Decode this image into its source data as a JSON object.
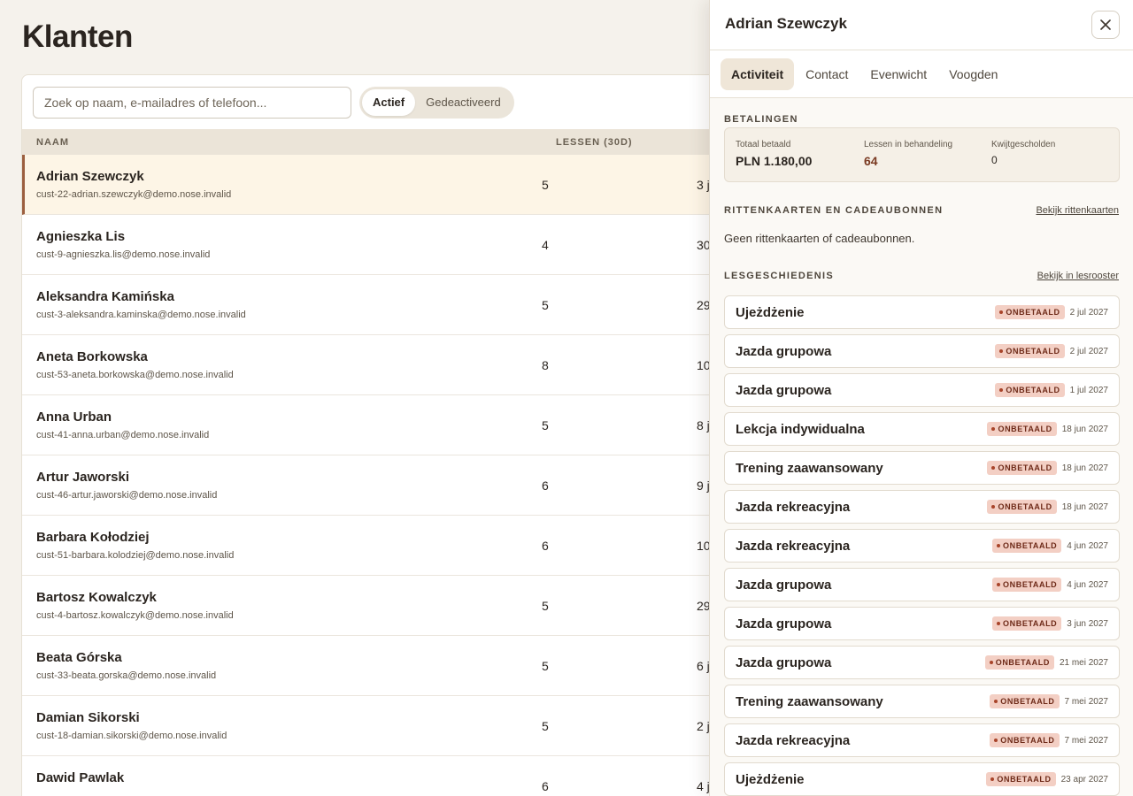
{
  "page": {
    "title": "Klanten"
  },
  "search": {
    "placeholder": "Zoek op naam, e-mailadres of telefoon..."
  },
  "filter": {
    "options": [
      "Actief",
      "Gedeactiveerd"
    ],
    "selected": "Actief"
  },
  "table": {
    "columns": {
      "name": "NAAM",
      "lessons": "LESSEN (30D)"
    },
    "rows": [
      {
        "name": "Adrian Szewczyk",
        "email": "cust-22-adrian.szewczyk@demo.nose.invalid",
        "lessons": "5",
        "last": "3 j",
        "selected": true
      },
      {
        "name": "Agnieszka Lis",
        "email": "cust-9-agnieszka.lis@demo.nose.invalid",
        "lessons": "4",
        "last": "30"
      },
      {
        "name": "Aleksandra Kamińska",
        "email": "cust-3-aleksandra.kaminska@demo.nose.invalid",
        "lessons": "5",
        "last": "29"
      },
      {
        "name": "Aneta Borkowska",
        "email": "cust-53-aneta.borkowska@demo.nose.invalid",
        "lessons": "8",
        "last": "10"
      },
      {
        "name": "Anna Urban",
        "email": "cust-41-anna.urban@demo.nose.invalid",
        "lessons": "5",
        "last": "8 j"
      },
      {
        "name": "Artur Jaworski",
        "email": "cust-46-artur.jaworski@demo.nose.invalid",
        "lessons": "6",
        "last": "9 j"
      },
      {
        "name": "Barbara Kołodziej",
        "email": "cust-51-barbara.kolodziej@demo.nose.invalid",
        "lessons": "6",
        "last": "10"
      },
      {
        "name": "Bartosz Kowalczyk",
        "email": "cust-4-bartosz.kowalczyk@demo.nose.invalid",
        "lessons": "5",
        "last": "29"
      },
      {
        "name": "Beata Górska",
        "email": "cust-33-beata.gorska@demo.nose.invalid",
        "lessons": "5",
        "last": "6 j"
      },
      {
        "name": "Damian Sikorski",
        "email": "cust-18-damian.sikorski@demo.nose.invalid",
        "lessons": "5",
        "last": "2 j"
      },
      {
        "name": "Dawid Pawlak",
        "email": "",
        "lessons": "6",
        "last": "4 j"
      }
    ]
  },
  "drawer": {
    "title": "Adrian Szewczyk",
    "close_icon": "close-icon",
    "tabs": [
      "Activiteit",
      "Contact",
      "Evenwicht",
      "Voogden"
    ],
    "active_tab": "Activiteit",
    "payments": {
      "label": "BETALINGEN",
      "total_label": "Totaal betaald",
      "total_value": "PLN 1.180,00",
      "pending_label": "Lessen in behandeling",
      "pending_value": "64",
      "waived_label": "Kwijtgescholden",
      "waived_value": "0"
    },
    "passes": {
      "label": "RITTENKAARTEN EN CADEAUBONNEN",
      "link": "Bekijk rittenkaarten",
      "empty": "Geen rittenkaarten of cadeaubonnen."
    },
    "history": {
      "label": "LESGESCHIEDENIS",
      "link": "Bekijk in lesrooster",
      "items": [
        {
          "name": "Ujeżdżenie",
          "status": "ONBETAALD",
          "date": "2 jul 2027"
        },
        {
          "name": "Jazda grupowa",
          "status": "ONBETAALD",
          "date": "2 jul 2027"
        },
        {
          "name": "Jazda grupowa",
          "status": "ONBETAALD",
          "date": "1 jul 2027"
        },
        {
          "name": "Lekcja indywidualna",
          "status": "ONBETAALD",
          "date": "18 jun 2027"
        },
        {
          "name": "Trening zaawansowany",
          "status": "ONBETAALD",
          "date": "18 jun 2027"
        },
        {
          "name": "Jazda rekreacyjna",
          "status": "ONBETAALD",
          "date": "18 jun 2027"
        },
        {
          "name": "Jazda rekreacyjna",
          "status": "ONBETAALD",
          "date": "4 jun 2027"
        },
        {
          "name": "Jazda grupowa",
          "status": "ONBETAALD",
          "date": "4 jun 2027"
        },
        {
          "name": "Jazda grupowa",
          "status": "ONBETAALD",
          "date": "3 jun 2027"
        },
        {
          "name": "Jazda grupowa",
          "status": "ONBETAALD",
          "date": "21 mei 2027"
        },
        {
          "name": "Trening zaawansowany",
          "status": "ONBETAALD",
          "date": "7 mei 2027"
        },
        {
          "name": "Jazda rekreacyjna",
          "status": "ONBETAALD",
          "date": "7 mei 2027"
        },
        {
          "name": "Ujeżdżenie",
          "status": "ONBETAALD",
          "date": "23 apr 2027"
        }
      ]
    }
  }
}
